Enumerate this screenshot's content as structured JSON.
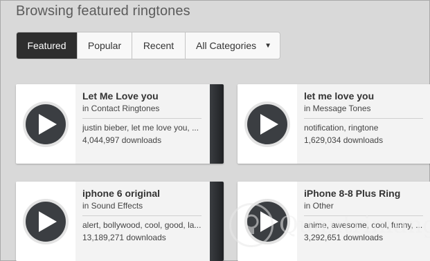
{
  "page": {
    "title": "Browsing featured ringtones"
  },
  "tabs": [
    {
      "label": "Featured",
      "active": true
    },
    {
      "label": "Popular",
      "active": false
    },
    {
      "label": "Recent",
      "active": false
    },
    {
      "label": "All Categories",
      "active": false
    }
  ],
  "ringtones": [
    {
      "name": "Let Me Love you",
      "category": "in Contact Ringtones",
      "tags": "justin bieber, let me love you, ...",
      "downloads": "4,044,997 downloads"
    },
    {
      "name": "let me love you",
      "category": "in Message Tones",
      "tags": "notification, ringtone",
      "downloads": "1,629,034 downloads"
    },
    {
      "name": "iphone 6 original",
      "category": "in Sound Effects",
      "tags": "alert, bollywood, cool, good, la...",
      "downloads": "13,189,271 downloads"
    },
    {
      "name": "iPhone 8-8 Plus Ring",
      "category": "in Other",
      "tags": "anime, awesome, cool, funny, ...",
      "downloads": "3,292,651 downloads"
    }
  ],
  "watermark": {
    "text": "Quantrimang"
  },
  "colors": {
    "tab_active_bg": "#2e2e2e",
    "play_button": "#3b3e42",
    "page_bg": "#d9d9d9"
  }
}
